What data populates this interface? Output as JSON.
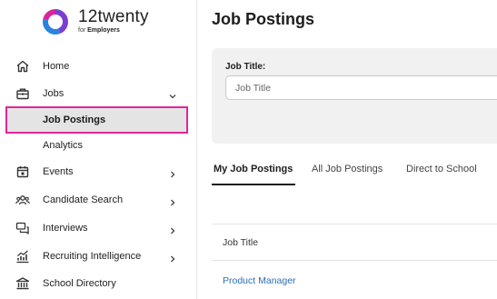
{
  "brand": {
    "name": "12twenty",
    "sub_prefix": "for",
    "sub_strong": "Employers",
    "colors": {
      "ring_purple": "#7a3fd1",
      "ring_blue": "#2b82e0",
      "ring_magenta": "#d7269a"
    }
  },
  "sidebar": {
    "items": [
      {
        "label": "Home",
        "icon": "home-icon",
        "chevron": ""
      },
      {
        "label": "Jobs",
        "icon": "briefcase-icon",
        "chevron": "down"
      },
      {
        "label": "Job Postings",
        "icon": "",
        "chevron": "",
        "active": true
      },
      {
        "label": "Analytics",
        "icon": "",
        "chevron": ""
      },
      {
        "label": "Events",
        "icon": "calendar-icon",
        "chevron": "right"
      },
      {
        "label": "Candidate Search",
        "icon": "people-icon",
        "chevron": "right"
      },
      {
        "label": "Interviews",
        "icon": "chat-icon",
        "chevron": "right"
      },
      {
        "label": "Recruiting Intelligence",
        "icon": "chart-icon",
        "chevron": "right"
      },
      {
        "label": "School Directory",
        "icon": "bank-icon",
        "chevron": ""
      }
    ],
    "active_highlight_color": "#e0269b"
  },
  "main": {
    "title": "Job Postings",
    "filter": {
      "label": "Job Title:",
      "placeholder": "Job Title",
      "value": ""
    },
    "tabs": [
      {
        "label": "My Job Postings",
        "active": true
      },
      {
        "label": "All Job Postings",
        "active": false
      },
      {
        "label": "Direct to School",
        "active": false
      }
    ],
    "table": {
      "columns": [
        "Job Title"
      ],
      "rows": [
        [
          "Product Manager"
        ]
      ]
    },
    "link_color": "#2a6fb8"
  }
}
